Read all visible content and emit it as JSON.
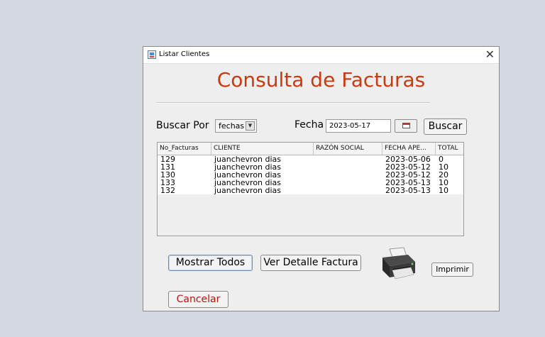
{
  "window": {
    "title": "Listar Clientes",
    "close_glyph": "✕"
  },
  "heading": "Consulta de Facturas",
  "filters": {
    "buscar_label": "Buscar Por",
    "combo_value": "fechas",
    "fecha_label": "Fecha",
    "date_value": "2023-05-17",
    "search_button": "Buscar"
  },
  "table": {
    "columns": [
      "No_Facturas",
      "CLIENTE",
      "RAZÓN SOCIAL",
      "FECHA APE...",
      "TOTAL"
    ],
    "rows": [
      [
        "129",
        "juanchevron dias",
        "",
        "2023-05-06",
        "0"
      ],
      [
        "131",
        "juanchevron dias",
        "",
        "2023-05-12",
        "10"
      ],
      [
        "130",
        "juanchevron dias",
        "",
        "2023-05-12",
        "20"
      ],
      [
        "133",
        "juanchevron dias",
        "",
        "2023-05-13",
        "10"
      ],
      [
        "132",
        "juanchevron dias",
        "",
        "2023-05-13",
        "10"
      ]
    ]
  },
  "buttons": {
    "show_all": "Mostrar Todos",
    "detail": "Ver Detalle Factura",
    "print": "Imprimir",
    "cancel": "Cancelar"
  },
  "colors": {
    "heading": "#c83a10",
    "cancel_text": "#c01010"
  }
}
